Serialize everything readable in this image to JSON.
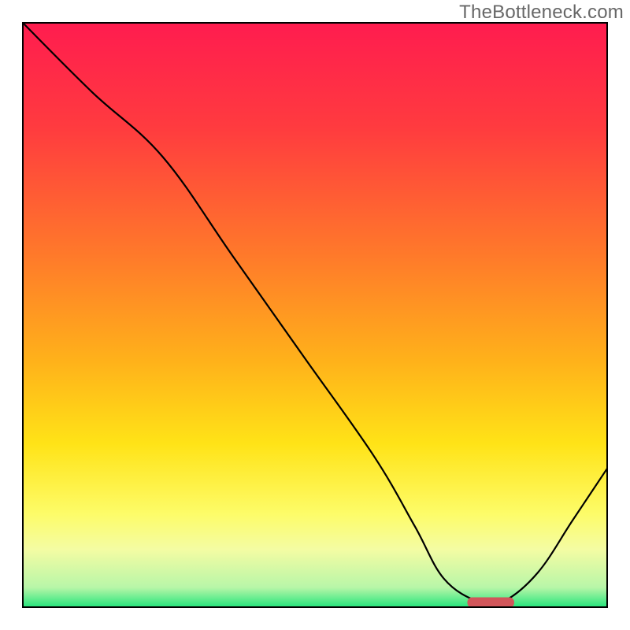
{
  "watermark": "TheBottleneck.com",
  "chart_data": {
    "type": "line",
    "title": "",
    "xlabel": "",
    "ylabel": "",
    "xlim": [
      0,
      100
    ],
    "ylim": [
      0,
      100
    ],
    "gradient_stops": [
      {
        "offset": 0.0,
        "color": "#ff1c4f"
      },
      {
        "offset": 0.18,
        "color": "#ff3b3f"
      },
      {
        "offset": 0.4,
        "color": "#ff7a2a"
      },
      {
        "offset": 0.58,
        "color": "#ffb21a"
      },
      {
        "offset": 0.72,
        "color": "#ffe317"
      },
      {
        "offset": 0.84,
        "color": "#fdfc69"
      },
      {
        "offset": 0.9,
        "color": "#f4fca3"
      },
      {
        "offset": 0.965,
        "color": "#b8f6a8"
      },
      {
        "offset": 1.0,
        "color": "#1fe47a"
      }
    ],
    "series": [
      {
        "name": "bottleneck-curve",
        "x": [
          0,
          12,
          24,
          36,
          48,
          60,
          67,
          72,
          78,
          82,
          88,
          94,
          100
        ],
        "y": [
          100,
          88,
          77,
          60,
          43,
          26,
          14,
          5,
          1,
          1,
          6,
          15,
          24
        ]
      }
    ],
    "marker": {
      "name": "optimal-range",
      "x_start": 76,
      "x_end": 84,
      "y": 1,
      "color": "#d1565a"
    }
  }
}
